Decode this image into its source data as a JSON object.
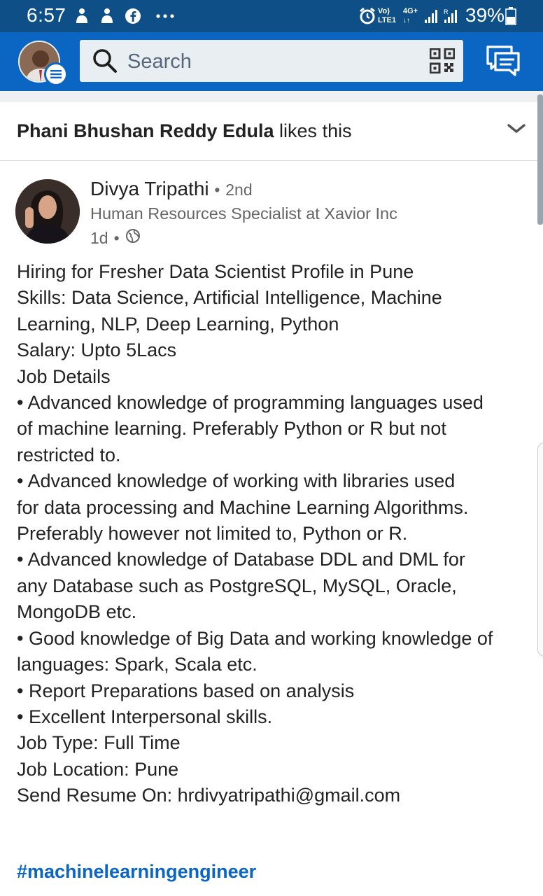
{
  "status_bar": {
    "time": "6:57",
    "network_top": "Vo)",
    "network_bottom": "LTE1",
    "network2_top": "4G+",
    "battery": "39%",
    "icons": [
      "notification-icon",
      "notification-icon",
      "facebook-icon",
      "more-icon",
      "alarm-icon",
      "signal-icon",
      "signal-icon",
      "battery-icon"
    ]
  },
  "header": {
    "search_placeholder": "Search",
    "icons": [
      "profile-avatar",
      "menu-icon",
      "search-icon",
      "qr-code-icon",
      "messaging-icon"
    ],
    "accent_color": "#0a66c2"
  },
  "social_context": {
    "name": "Phani Bhushan Reddy Edula",
    "action": " likes this"
  },
  "post": {
    "author": {
      "name": "Divya Tripathi",
      "separator": "•",
      "degree": "2nd",
      "headline": "Human Resources Specialist at Xavior Inc",
      "time": "1d",
      "visibility_icon": "globe-icon"
    },
    "lines": [
      "Hiring for Fresher Data Scientist Profile in Pune",
      "Skills: Data Science, Artificial Intelligence, Machine",
      "Learning, NLP, Deep Learning, Python",
      "Salary: Upto 5Lacs",
      "Job Details",
      "• Advanced knowledge of programming languages used",
      "of machine learning. Preferably Python or R but not",
      "restricted to.",
      "• Advanced knowledge of working with libraries used",
      "for data processing and Machine Learning Algorithms.",
      "Preferably however not limited to, Python or R.",
      "• Advanced knowledge of Database DDL and DML for",
      "any Database such as PostgreSQL, MySQL, Oracle,",
      "MongoDB etc.",
      "• Good knowledge of Big Data and working knowledge of",
      "languages: Spark, Scala etc.",
      "• Report Preparations based on analysis",
      "• Excellent Interpersonal skills.",
      "Job Type: Full Time",
      "Job Location: Pune",
      "Send Resume On: hrdivyatripathi@gmail.com"
    ],
    "hashtag": "#machinelearningengineer"
  }
}
